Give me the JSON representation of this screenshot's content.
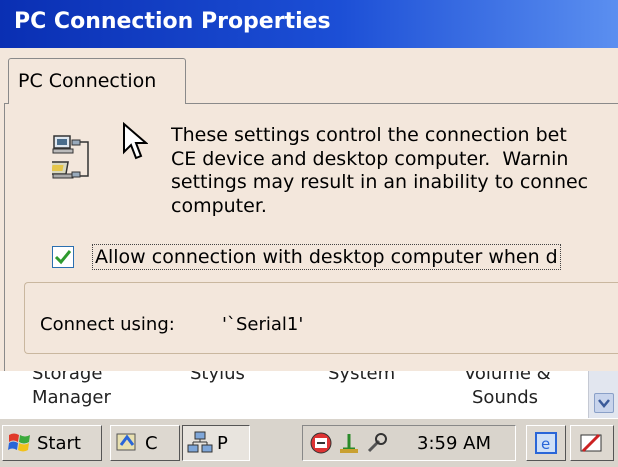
{
  "window": {
    "title": "PC Connection Properties"
  },
  "tabs": [
    {
      "label": "PC Connection"
    }
  ],
  "description": {
    "lines": [
      "These settings control the connection bet",
      "CE device and desktop computer.  Warnin",
      "settings may result in an inability to connec",
      "computer."
    ]
  },
  "allow_connection": {
    "label": "Allow connection with desktop computer when d",
    "checked": true
  },
  "connect_using": {
    "label": "Connect using:",
    "value": "'`Serial1'"
  },
  "control_panel_items": [
    {
      "line1": "Storage",
      "line2": "Manager"
    },
    {
      "line1": "Stylus",
      "line2": ""
    },
    {
      "line1": "System",
      "line2": ""
    },
    {
      "line1": "Volume &",
      "line2": "Sounds"
    }
  ],
  "taskbar": {
    "start_label": "Start",
    "task1_label": "C",
    "task2_label": "P",
    "clock": "3:59 AM"
  },
  "colors": {
    "titlebar_start": "#0a2fb3",
    "titlebar_end": "#5b8ff0",
    "dialog_bg": "#f3e7dc",
    "check_green": "#2e9a2e"
  },
  "icons": [
    "pc-connection-icon",
    "mouse-cursor-icon",
    "checkmark-icon",
    "windows-flag-icon",
    "control-panel-icon",
    "network-icon",
    "network-tray-icon",
    "usb-tray-icon",
    "tools-tray-icon",
    "desktop-icon",
    "pen-icon",
    "chevron-down-icon"
  ]
}
